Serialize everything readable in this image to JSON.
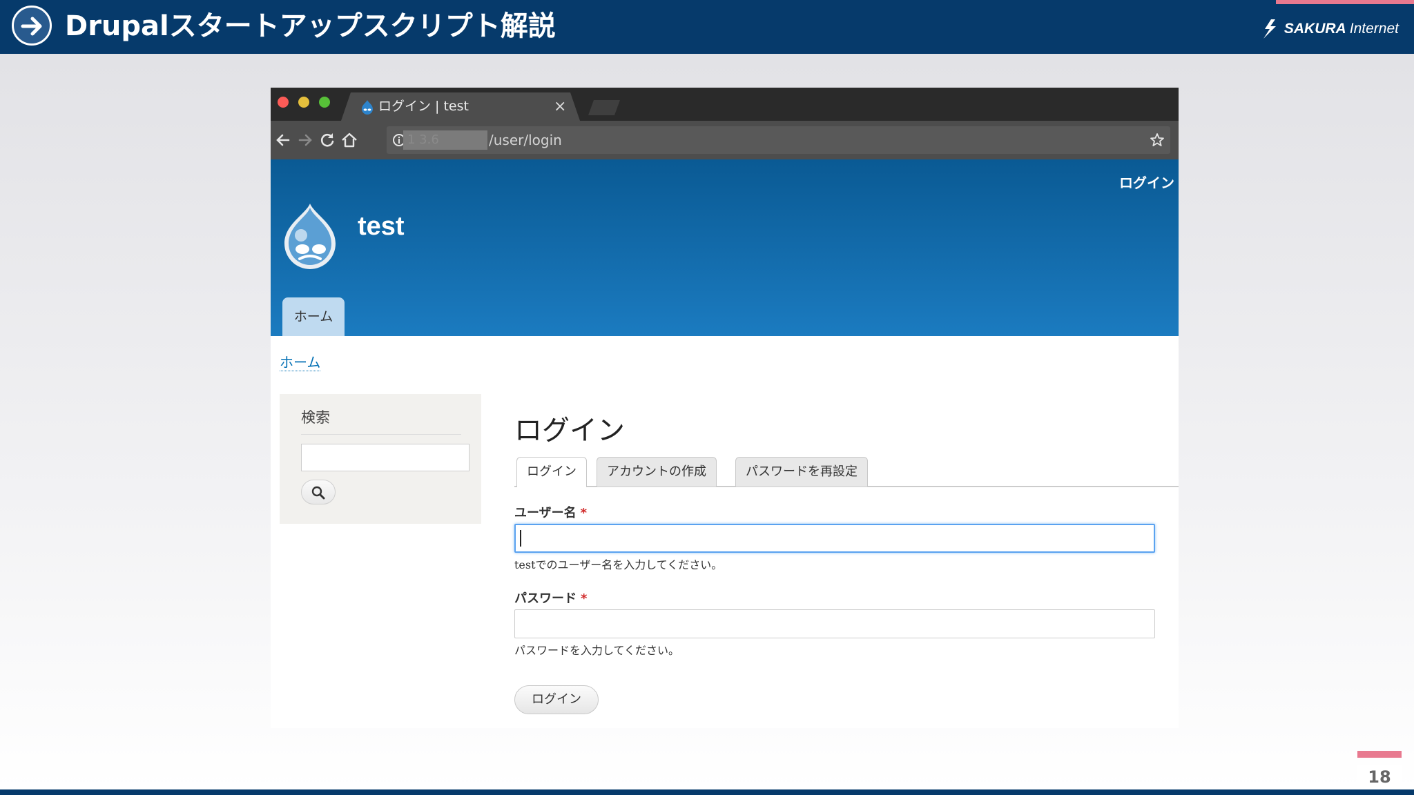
{
  "slide": {
    "title": "Drupalスタートアップスクリプト解説",
    "logo_text": "SAKURA",
    "logo_text_2": "Internet",
    "page_number": "18"
  },
  "browser": {
    "tab_title": "ログイン | test",
    "tab_close": "×",
    "url_host_partial": "1 3.6",
    "url_path": "/user/login"
  },
  "site": {
    "header_login": "ログイン",
    "name": "test",
    "nav_home": "ホーム",
    "breadcrumb": "ホーム"
  },
  "sidebar": {
    "search_title": "検索"
  },
  "main": {
    "title": "ログイン",
    "tabs": [
      {
        "label": "ログイン"
      },
      {
        "label": "アカウントの作成"
      },
      {
        "label": "パスワードを再設定"
      }
    ],
    "username_label": "ユーザー名",
    "username_desc": "testでのユーザー名を入力してください。",
    "password_label": "パスワード",
    "password_desc": "パスワードを入力してください。",
    "required_mark": "*",
    "submit": "ログイン"
  },
  "colors": {
    "slide_header": "#063a6b",
    "accent_pink": "#e8798f",
    "drupal_blue": "#1b7bc0",
    "focus_blue": "#5aa2f0"
  },
  "icons": [
    "arrow-right-icon",
    "sakura-logo-icon",
    "drupal-favicon-icon",
    "back-icon",
    "forward-icon",
    "reload-icon",
    "home-icon",
    "info-icon",
    "star-icon",
    "drupal-logo-icon",
    "search-icon"
  ]
}
